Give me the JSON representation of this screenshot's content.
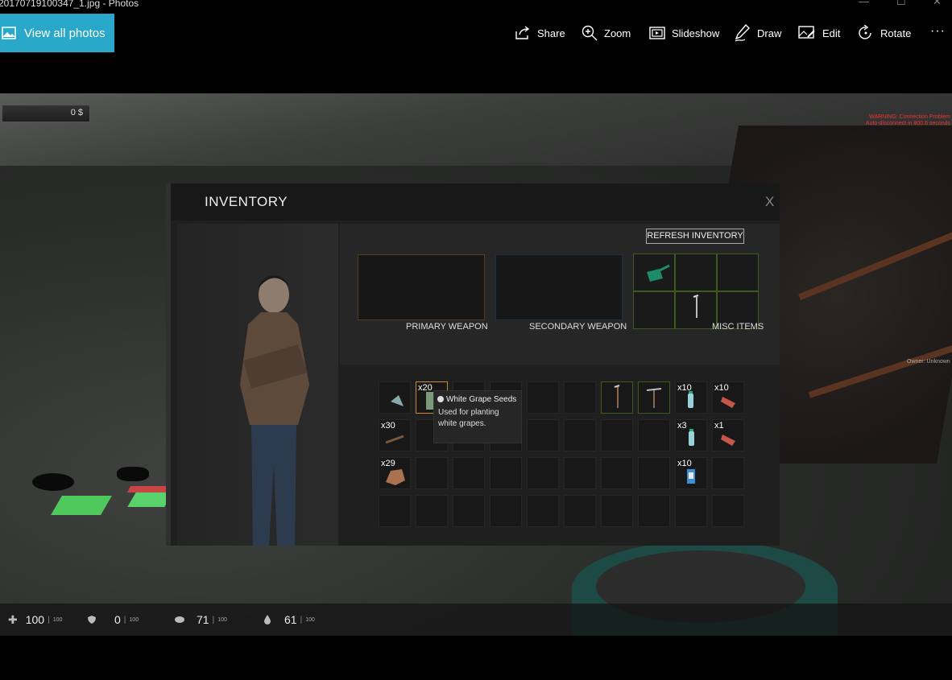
{
  "window": {
    "title": "20170719100347_1.jpg - Photos"
  },
  "toolbar": {
    "view_all": "View all photos",
    "share": "Share",
    "zoom": "Zoom",
    "slideshow": "Slideshow",
    "draw": "Draw",
    "edit": "Edit",
    "rotate": "Rotate",
    "more": "···"
  },
  "game": {
    "money": "0 $",
    "warning_line1": "WARNING: Connection Problem",
    "warning_line2": "Auto-disconnect in 800.6 seconds",
    "owner": "Owner: Unknown"
  },
  "inventory": {
    "title": "INVENTORY",
    "close": "X",
    "refresh": "REFRESH INVENTORY",
    "primary_label": "PRIMARY WEAPON",
    "secondary_label": "SECONDARY WEAPON",
    "misc_label": "MISC ITEMS",
    "counts": {
      "c2": "x20",
      "c9": "x10",
      "c10": "x10",
      "c11": "x30",
      "c19": "x3",
      "c20": "x1",
      "c21": "x29",
      "c29": "x10"
    }
  },
  "tooltip": {
    "title": "White Grape Seeds",
    "description": "Used for planting white grapes."
  },
  "hud": {
    "health": "100",
    "health_max": "100",
    "armor": "0",
    "armor_max": "100",
    "hunger": "71",
    "hunger_max": "100",
    "thirst": "61",
    "thirst_max": "100",
    "sep": "|"
  },
  "colors": {
    "accent": "#2aa8c9",
    "warning": "#e33333",
    "slot_green": "#3f5a1e",
    "slot_selected": "#c78a3a"
  }
}
